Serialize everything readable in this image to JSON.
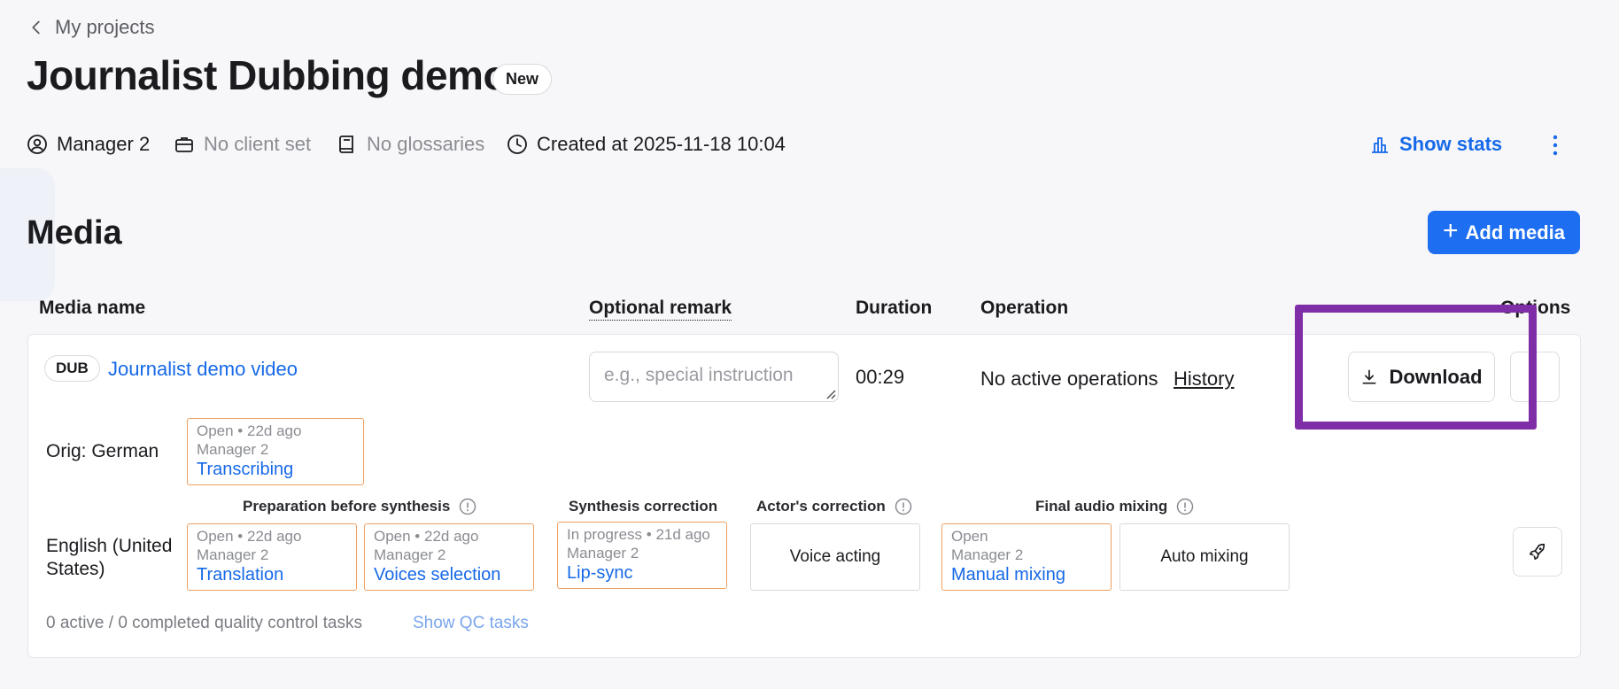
{
  "breadcrumb": {
    "back_label": "My projects"
  },
  "project": {
    "title": "Journalist Dubbing demo",
    "status_badge": "New",
    "manager": "Manager 2",
    "client": "No client set",
    "glossaries": "No glossaries",
    "created": "Created at 2025-11-18 10:04",
    "show_stats_label": "Show stats"
  },
  "media_section": {
    "title": "Media",
    "add_media_label": "Add media",
    "columns": {
      "media_name": "Media name",
      "optional_remark": "Optional remark",
      "duration": "Duration",
      "operation": "Operation",
      "options": "Options"
    }
  },
  "media_item": {
    "type_badge": "DUB",
    "name": "Journalist demo video",
    "remark_placeholder": "e.g., special instruction",
    "remark_value": "",
    "duration": "00:29",
    "operation_status": "No active operations",
    "history_label": "History",
    "download_label": "Download",
    "original": {
      "label": "Orig: German",
      "task": {
        "meta": "Open • 22d ago",
        "assignee": "Manager 2",
        "link": "Transcribing"
      }
    },
    "target": {
      "label": "English (United States)",
      "groups": {
        "preparation": "Preparation before synthesis",
        "synthesis": "Synthesis correction",
        "actor": "Actor's correction",
        "final": "Final audio mixing"
      },
      "tasks": {
        "translation": {
          "meta": "Open • 22d ago",
          "assignee": "Manager 2",
          "link": "Translation"
        },
        "voices": {
          "meta": "Open • 22d ago",
          "assignee": "Manager 2",
          "link": "Voices selection"
        },
        "lipsync": {
          "meta": "In progress • 21d ago",
          "assignee": "Manager 2",
          "link": "Lip-sync"
        },
        "voice_acting": {
          "label": "Voice acting"
        },
        "manual_mixing": {
          "meta": "Open",
          "assignee": "Manager 2",
          "link": "Manual mixing"
        },
        "auto_mixing": {
          "label": "Auto mixing"
        }
      }
    },
    "qc": {
      "summary": "0 active / 0 completed quality control tasks",
      "show_label": "Show QC tasks"
    }
  },
  "colors": {
    "accent": "#1d6ef0",
    "link": "#1669e8",
    "task_border": "#f0a060",
    "highlight": "#7f2ea8"
  },
  "icons": [
    "chevron-left-icon",
    "user-circle-icon",
    "briefcase-icon",
    "book-icon",
    "clock-icon",
    "bar-chart-icon",
    "kebab-menu-icon",
    "plus-icon",
    "download-icon",
    "info-icon",
    "rocket-icon"
  ]
}
